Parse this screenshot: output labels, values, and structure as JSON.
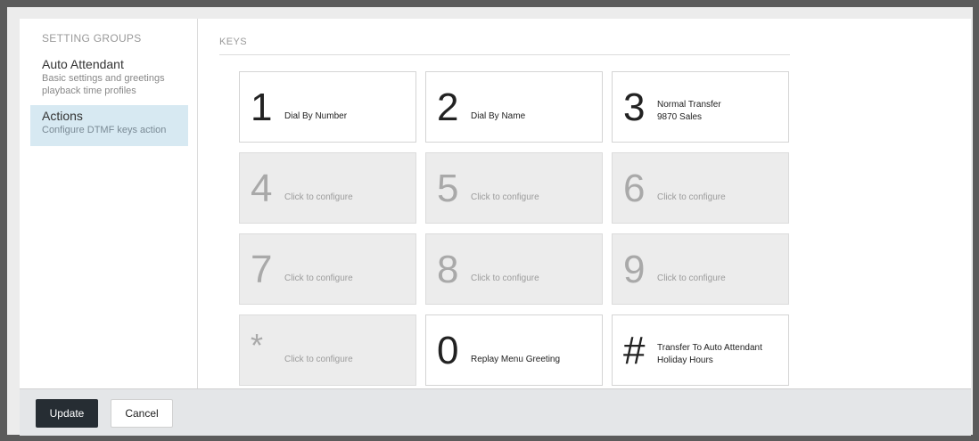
{
  "sidebar": {
    "heading": "SETTING GROUPS",
    "items": [
      {
        "title": "Auto Attendant",
        "desc_line1": "Basic settings and greetings",
        "desc_line2": "playback time profiles"
      },
      {
        "title": "Actions",
        "desc_line1": "Configure DTMF keys action"
      }
    ]
  },
  "main": {
    "heading": "KEYS",
    "keys": [
      {
        "digit": "1",
        "line1": "Dial By Number"
      },
      {
        "digit": "2",
        "line1": "Dial By Name"
      },
      {
        "digit": "3",
        "line1": "Normal Transfer",
        "line2": "9870 Sales"
      },
      {
        "digit": "4",
        "line1": "Click to configure"
      },
      {
        "digit": "5",
        "line1": "Click to configure"
      },
      {
        "digit": "6",
        "line1": "Click to configure"
      },
      {
        "digit": "7",
        "line1": "Click to configure"
      },
      {
        "digit": "8",
        "line1": "Click to configure"
      },
      {
        "digit": "9",
        "line1": "Click to configure"
      },
      {
        "digit": "*",
        "line1": "Click to configure"
      },
      {
        "digit": "0",
        "line1": "Replay Menu Greeting"
      },
      {
        "digit": "#",
        "line1": "Transfer To Auto Attendant",
        "line2": "Holiday Hours"
      }
    ]
  },
  "footer": {
    "update_label": "Update",
    "cancel_label": "Cancel"
  },
  "colors": {
    "selected_nav_bg": "#d7e9f2",
    "primary_button": "#262d33",
    "unconfigured_key_bg": "#ececec"
  }
}
